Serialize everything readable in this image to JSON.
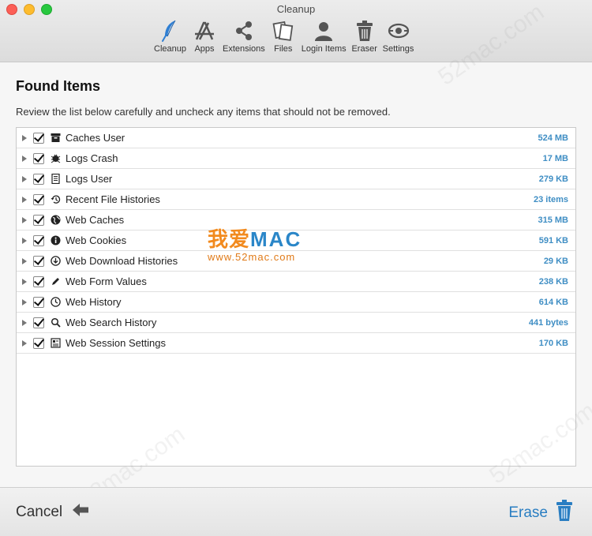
{
  "window": {
    "title": "Cleanup"
  },
  "toolbar": {
    "items": [
      {
        "label": "Cleanup",
        "icon": "feather-icon",
        "active": true
      },
      {
        "label": "Apps",
        "icon": "app-store-icon"
      },
      {
        "label": "Extensions",
        "icon": "share-icon"
      },
      {
        "label": "Files",
        "icon": "files-icon"
      },
      {
        "label": "Login Items",
        "icon": "user-icon"
      },
      {
        "label": "Eraser",
        "icon": "trash-icon"
      },
      {
        "label": "Settings",
        "icon": "settings-icon"
      }
    ]
  },
  "main": {
    "heading": "Found Items",
    "instructions": "Review the list below carefully and uncheck any items that should not be removed.",
    "items": [
      {
        "label": "Caches User",
        "size": "524 MB",
        "icon": "archive-box-icon",
        "checked": true
      },
      {
        "label": "Logs Crash",
        "size": "17 MB",
        "icon": "bug-icon",
        "checked": true
      },
      {
        "label": "Logs User",
        "size": "279 KB",
        "icon": "document-icon",
        "checked": true
      },
      {
        "label": "Recent File Histories",
        "size": "23 items",
        "icon": "history-icon",
        "checked": true
      },
      {
        "label": "Web Caches",
        "size": "315 MB",
        "icon": "globe-icon",
        "checked": true
      },
      {
        "label": "Web Cookies",
        "size": "591 KB",
        "icon": "info-icon",
        "checked": true
      },
      {
        "label": "Web Download Histories",
        "size": "29 KB",
        "icon": "download-icon",
        "checked": true
      },
      {
        "label": "Web Form Values",
        "size": "238 KB",
        "icon": "pencil-icon",
        "checked": true
      },
      {
        "label": "Web History",
        "size": "614 KB",
        "icon": "clock-icon",
        "checked": true
      },
      {
        "label": "Web Search History",
        "size": "441 bytes",
        "icon": "magnifier-icon",
        "checked": true
      },
      {
        "label": "Web Session Settings",
        "size": "170 KB",
        "icon": "session-icon",
        "checked": true
      }
    ]
  },
  "footer": {
    "cancel_label": "Cancel",
    "erase_label": "Erase"
  },
  "watermark": {
    "cn": "我爱",
    "en": "MAC",
    "url": "www.52mac.com",
    "faint": "52mac.com"
  },
  "colors": {
    "accent": "#2a7ec2",
    "size_text": "#3f8ec4",
    "active_icon": "#2f7fd3"
  }
}
